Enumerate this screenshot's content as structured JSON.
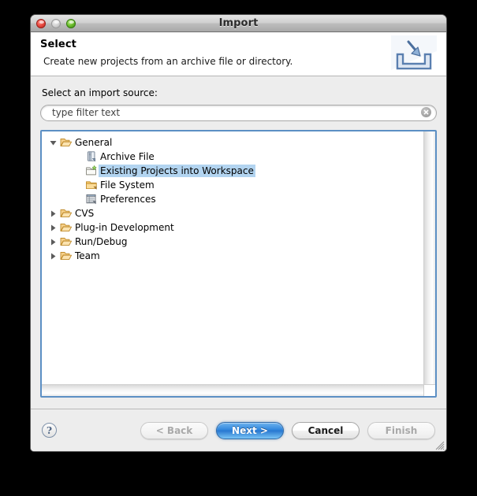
{
  "window": {
    "title": "Import",
    "controls": {
      "close": "close-button",
      "minimize": "minimize-button",
      "maximize": "maximize-button"
    }
  },
  "header": {
    "title": "Select",
    "subtitle": "Create new projects from an archive file or directory.",
    "icon": "import-wizard-icon"
  },
  "main": {
    "field_label": "Select an import source:",
    "filter": {
      "value": "",
      "placeholder": "type filter text",
      "clear_icon": "clear-circle-icon"
    },
    "tree": [
      {
        "label": "General",
        "level": 0,
        "expanded": true,
        "icon": "folder-open-icon",
        "selected": false
      },
      {
        "label": "Archive File",
        "level": 1,
        "expanded": null,
        "icon": "archive-file-icon",
        "selected": false
      },
      {
        "label": "Existing Projects into Workspace",
        "level": 1,
        "expanded": null,
        "icon": "existing-projects-icon",
        "selected": true
      },
      {
        "label": "File System",
        "level": 1,
        "expanded": null,
        "icon": "file-system-folder-icon",
        "selected": false
      },
      {
        "label": "Preferences",
        "level": 1,
        "expanded": null,
        "icon": "preferences-icon",
        "selected": false
      },
      {
        "label": "CVS",
        "level": 0,
        "expanded": false,
        "icon": "folder-open-icon",
        "selected": false
      },
      {
        "label": "Plug-in Development",
        "level": 0,
        "expanded": false,
        "icon": "folder-open-icon",
        "selected": false
      },
      {
        "label": "Run/Debug",
        "level": 0,
        "expanded": false,
        "icon": "folder-open-icon",
        "selected": false
      },
      {
        "label": "Team",
        "level": 0,
        "expanded": false,
        "icon": "folder-open-icon",
        "selected": false
      }
    ]
  },
  "footer": {
    "help_label": "?",
    "buttons": [
      {
        "label": "< Back",
        "state": "disabled",
        "name": "back-button"
      },
      {
        "label": "Next >",
        "state": "default",
        "name": "next-button"
      },
      {
        "label": "Cancel",
        "state": "normal",
        "name": "cancel-button"
      },
      {
        "label": "Finish",
        "state": "disabled",
        "name": "finish-button"
      }
    ]
  },
  "colors": {
    "selection": "#b2d4f0",
    "focus_border": "#5c8fc4",
    "default_button": "#2f86dd",
    "window_bg": "#ededed"
  }
}
